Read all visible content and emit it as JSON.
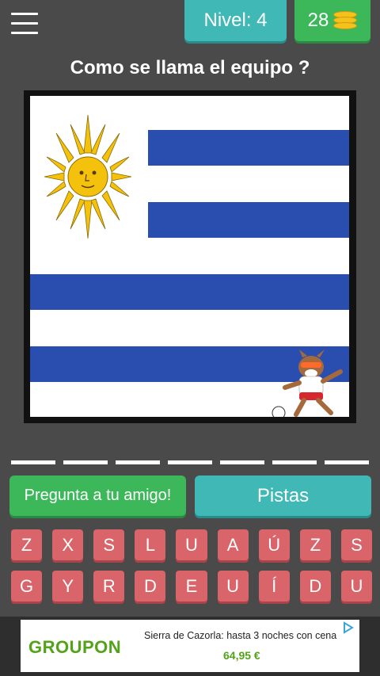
{
  "header": {
    "level_label": "Nivel: 4",
    "coins": "28"
  },
  "question": "Como se llama el equipo ?",
  "image": {
    "subject": "uruguay-flag",
    "colors": {
      "blue": "#2a4db0",
      "white": "#ffffff",
      "sun": "#f4c20d"
    }
  },
  "answer_slots": 7,
  "buttons": {
    "ask_friend": "Pregunta a tu amigo!",
    "hints": "Pistas"
  },
  "keyboard": {
    "row1": [
      "Z",
      "X",
      "S",
      "L",
      "U",
      "A",
      "Ú",
      "Z",
      "S"
    ],
    "row2": [
      "G",
      "Y",
      "R",
      "D",
      "E",
      "U",
      "Í",
      "D",
      "U"
    ]
  },
  "ad": {
    "brand": "GROUPON",
    "text": "Sierra de Cazorla: hasta 3 noches con cena",
    "price": "64,95 €"
  },
  "colors": {
    "background": "#4a4a4a",
    "teal": "#3fb8b6",
    "green": "#3cb85a",
    "key_red": "#d9646a"
  }
}
